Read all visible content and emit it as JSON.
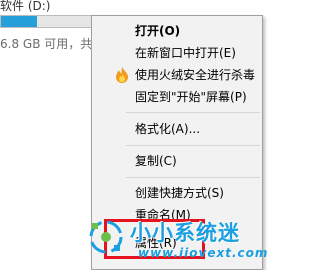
{
  "explorer": {
    "drive_name": "软件 (D:)",
    "drive_info": "6.8 GB 可用，共",
    "usage_fraction": 0.32,
    "bar_color": "#26a0da"
  },
  "context_menu": {
    "items": [
      {
        "label": "打开(O)",
        "bold": true
      },
      {
        "label": "在新窗口中打开(E)"
      },
      {
        "label": "使用火绒安全进行杀毒",
        "icon": "huorong-flame-icon"
      },
      {
        "label": "固定到\"开始\"屏幕(P)"
      },
      {
        "label": "格式化(A)..."
      },
      {
        "label": "复制(C)"
      },
      {
        "label": "创建快捷方式(S)"
      },
      {
        "label": "重命名(M)"
      },
      {
        "label": "属性(R)"
      }
    ]
  },
  "highlight": {
    "color": "#e5131d",
    "target": "属性(R)"
  },
  "watermark": {
    "text": "小小系统迷",
    "url": "www.iiovext.com",
    "color": "#1a9fe0"
  }
}
